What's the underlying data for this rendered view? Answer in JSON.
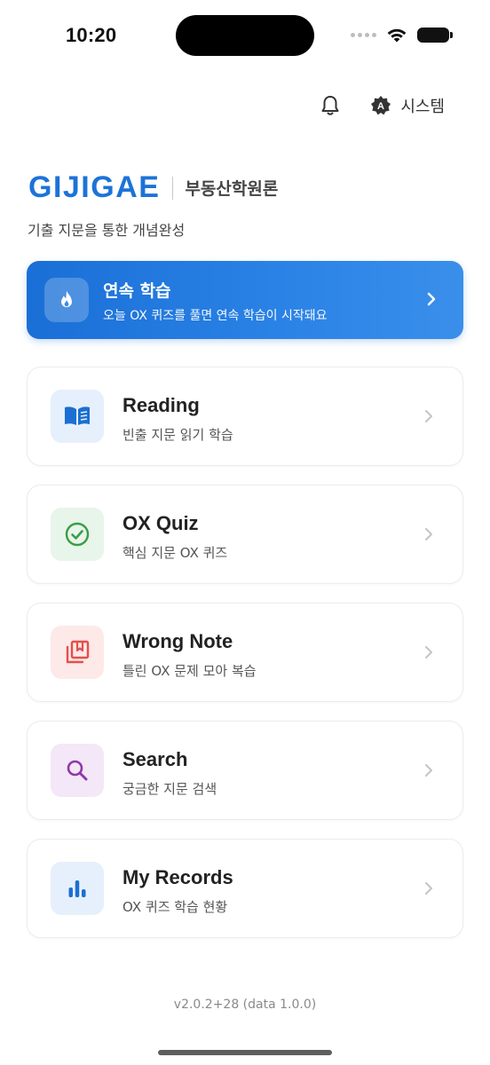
{
  "status_bar": {
    "time": "10:20",
    "icons": [
      "cellular-dots-icon",
      "wifi-icon",
      "battery-icon"
    ]
  },
  "top_actions": {
    "bell_icon": "bell-icon",
    "theme_icon": "auto-theme-icon",
    "theme_label": "시스템"
  },
  "brand": {
    "logo": "GIJIGAE",
    "subject": "부동산학원론",
    "tagline": "기출 지문을 통한 개념완성",
    "color": "#1c73d8"
  },
  "streak": {
    "title": "연속 학습",
    "description": "오늘 OX 퀴즈를 풀면 연속 학습이 시작돼요",
    "icon": "flame-icon",
    "color": "#1a6fd6"
  },
  "menu": [
    {
      "title": "Reading",
      "subtitle": "빈출 지문 읽기 학습",
      "icon": "book-icon",
      "color": "#1c6fd1",
      "bg": "#e6f0fc"
    },
    {
      "title": "OX Quiz",
      "subtitle": "핵심 지문 OX 퀴즈",
      "icon": "check-circle-icon",
      "color": "#3a9d46",
      "bg": "#e8f5ea"
    },
    {
      "title": "Wrong Note",
      "subtitle": "틀린 OX 문제 모아 복습",
      "icon": "bookmark-stack-icon",
      "color": "#e2504c",
      "bg": "#fde9e8"
    },
    {
      "title": "Search",
      "subtitle": "궁금한 지문 검색",
      "icon": "search-icon",
      "color": "#8e3aa8",
      "bg": "#f4e7f8"
    },
    {
      "title": "My Records",
      "subtitle": "OX 퀴즈 학습 현황",
      "icon": "bar-chart-icon",
      "color": "#1c6fd1",
      "bg": "#e6f0fc"
    }
  ],
  "version": "v2.0.2+28 (data 1.0.0)"
}
